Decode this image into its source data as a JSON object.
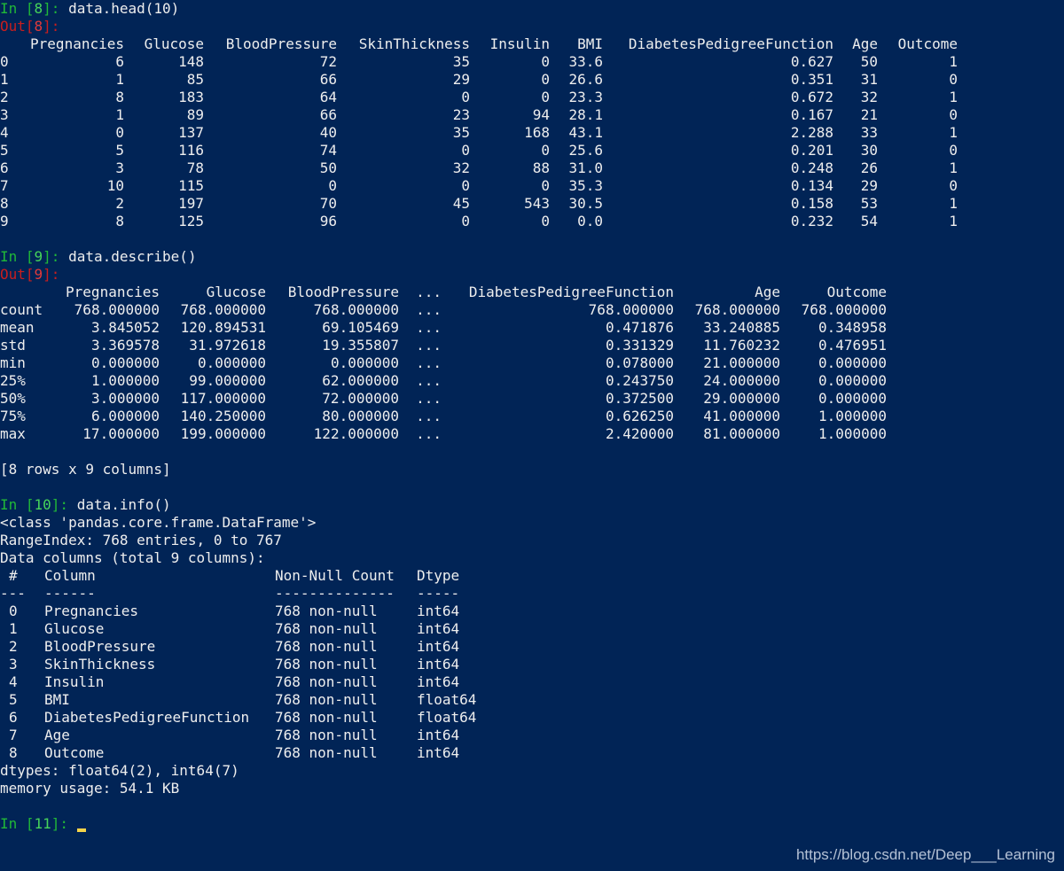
{
  "theme": {
    "background": "#012456",
    "text": "#eeeeee",
    "in_prompt": "#21b838",
    "out_prompt": "#c81e1e",
    "cursor": "#f5d44a"
  },
  "cells": [
    {
      "in_label": "In [",
      "in_num": "8",
      "in_close": "]: ",
      "command": "data.head(10)",
      "out_label": "Out[",
      "out_num": "8",
      "out_close": "]:"
    },
    {
      "in_label": "In [",
      "in_num": "9",
      "in_close": "]: ",
      "command": "data.describe()",
      "out_label": "Out[",
      "out_num": "9",
      "out_close": "]:"
    },
    {
      "in_label": "In [",
      "in_num": "10",
      "in_close": "]: ",
      "command": "data.info()"
    },
    {
      "in_label": "In [",
      "in_num": "11",
      "in_close": "]: "
    }
  ],
  "head_table": {
    "columns": [
      "Pregnancies",
      "Glucose",
      "BloodPressure",
      "SkinThickness",
      "Insulin",
      "BMI",
      "DiabetesPedigreeFunction",
      "Age",
      "Outcome"
    ],
    "rows": [
      {
        "index": "0",
        "values": [
          "6",
          "148",
          "72",
          "35",
          "0",
          "33.6",
          "0.627",
          "50",
          "1"
        ]
      },
      {
        "index": "1",
        "values": [
          "1",
          "85",
          "66",
          "29",
          "0",
          "26.6",
          "0.351",
          "31",
          "0"
        ]
      },
      {
        "index": "2",
        "values": [
          "8",
          "183",
          "64",
          "0",
          "0",
          "23.3",
          "0.672",
          "32",
          "1"
        ]
      },
      {
        "index": "3",
        "values": [
          "1",
          "89",
          "66",
          "23",
          "94",
          "28.1",
          "0.167",
          "21",
          "0"
        ]
      },
      {
        "index": "4",
        "values": [
          "0",
          "137",
          "40",
          "35",
          "168",
          "43.1",
          "2.288",
          "33",
          "1"
        ]
      },
      {
        "index": "5",
        "values": [
          "5",
          "116",
          "74",
          "0",
          "0",
          "25.6",
          "0.201",
          "30",
          "0"
        ]
      },
      {
        "index": "6",
        "values": [
          "3",
          "78",
          "50",
          "32",
          "88",
          "31.0",
          "0.248",
          "26",
          "1"
        ]
      },
      {
        "index": "7",
        "values": [
          "10",
          "115",
          "0",
          "0",
          "0",
          "35.3",
          "0.134",
          "29",
          "0"
        ]
      },
      {
        "index": "8",
        "values": [
          "2",
          "197",
          "70",
          "45",
          "543",
          "30.5",
          "0.158",
          "53",
          "1"
        ]
      },
      {
        "index": "9",
        "values": [
          "8",
          "125",
          "96",
          "0",
          "0",
          "0.0",
          "0.232",
          "54",
          "1"
        ]
      }
    ]
  },
  "describe_table": {
    "columns": [
      "Pregnancies",
      "Glucose",
      "BloodPressure",
      "...",
      "DiabetesPedigreeFunction",
      "Age",
      "Outcome"
    ],
    "rows": [
      {
        "index": "count",
        "values": [
          "768.000000",
          "768.000000",
          "768.000000",
          "...",
          "768.000000",
          "768.000000",
          "768.000000"
        ]
      },
      {
        "index": "mean",
        "values": [
          "3.845052",
          "120.894531",
          "69.105469",
          "...",
          "0.471876",
          "33.240885",
          "0.348958"
        ]
      },
      {
        "index": "std",
        "values": [
          "3.369578",
          "31.972618",
          "19.355807",
          "...",
          "0.331329",
          "11.760232",
          "0.476951"
        ]
      },
      {
        "index": "min",
        "values": [
          "0.000000",
          "0.000000",
          "0.000000",
          "...",
          "0.078000",
          "21.000000",
          "0.000000"
        ]
      },
      {
        "index": "25%",
        "values": [
          "1.000000",
          "99.000000",
          "62.000000",
          "...",
          "0.243750",
          "24.000000",
          "0.000000"
        ]
      },
      {
        "index": "50%",
        "values": [
          "3.000000",
          "117.000000",
          "72.000000",
          "...",
          "0.372500",
          "29.000000",
          "0.000000"
        ]
      },
      {
        "index": "75%",
        "values": [
          "6.000000",
          "140.250000",
          "80.000000",
          "...",
          "0.626250",
          "41.000000",
          "1.000000"
        ]
      },
      {
        "index": "max",
        "values": [
          "17.000000",
          "199.000000",
          "122.000000",
          "...",
          "2.420000",
          "81.000000",
          "1.000000"
        ]
      }
    ],
    "shape_note": "[8 rows x 9 columns]"
  },
  "info_output": {
    "class_line": "<class 'pandas.core.frame.DataFrame'>",
    "range_index": "RangeIndex: 768 entries, 0 to 767",
    "data_columns": "Data columns (total 9 columns):",
    "header": {
      "num": "#",
      "column": "Column",
      "count": "Non-Null Count",
      "dtype": "Dtype"
    },
    "dashes": {
      "num": "---",
      "column": "------",
      "count": "--------------",
      "dtype": "-----"
    },
    "rows": [
      {
        "num": "0",
        "column": "Pregnancies",
        "count": "768 non-null",
        "dtype": "int64"
      },
      {
        "num": "1",
        "column": "Glucose",
        "count": "768 non-null",
        "dtype": "int64"
      },
      {
        "num": "2",
        "column": "BloodPressure",
        "count": "768 non-null",
        "dtype": "int64"
      },
      {
        "num": "3",
        "column": "SkinThickness",
        "count": "768 non-null",
        "dtype": "int64"
      },
      {
        "num": "4",
        "column": "Insulin",
        "count": "768 non-null",
        "dtype": "int64"
      },
      {
        "num": "5",
        "column": "BMI",
        "count": "768 non-null",
        "dtype": "float64"
      },
      {
        "num": "6",
        "column": "DiabetesPedigreeFunction",
        "count": "768 non-null",
        "dtype": "float64"
      },
      {
        "num": "7",
        "column": "Age",
        "count": "768 non-null",
        "dtype": "int64"
      },
      {
        "num": "8",
        "column": "Outcome",
        "count": "768 non-null",
        "dtype": "int64"
      }
    ],
    "dtypes_line": "dtypes: float64(2), int64(7)",
    "memory_line": "memory usage: 54.1 KB"
  },
  "watermark": "https://blog.csdn.net/Deep___Learning"
}
